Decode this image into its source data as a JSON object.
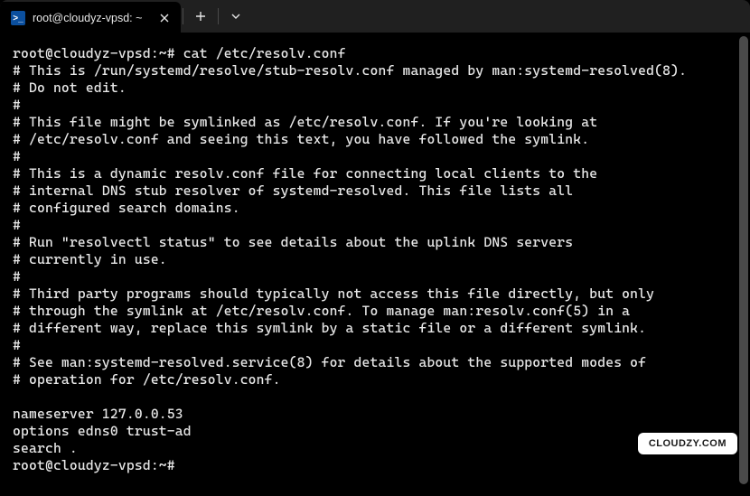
{
  "tab": {
    "title": "root@cloudyz-vpsd: ~",
    "icon_glyph": ">_"
  },
  "terminal": {
    "prompt1": "root@cloudyz-vpsd:~#",
    "command1": "cat /etc/resolv.conf",
    "lines": [
      "# This is /run/systemd/resolve/stub-resolv.conf managed by man:systemd-resolved(8).",
      "# Do not edit.",
      "#",
      "# This file might be symlinked as /etc/resolv.conf. If you're looking at",
      "# /etc/resolv.conf and seeing this text, you have followed the symlink.",
      "#",
      "# This is a dynamic resolv.conf file for connecting local clients to the",
      "# internal DNS stub resolver of systemd-resolved. This file lists all",
      "# configured search domains.",
      "#",
      "# Run \"resolvectl status\" to see details about the uplink DNS servers",
      "# currently in use.",
      "#",
      "# Third party programs should typically not access this file directly, but only",
      "# through the symlink at /etc/resolv.conf. To manage man:resolv.conf(5) in a",
      "# different way, replace this symlink by a static file or a different symlink.",
      "#",
      "# See man:systemd-resolved.service(8) for details about the supported modes of",
      "# operation for /etc/resolv.conf.",
      "",
      "nameserver 127.0.0.53",
      "options edns0 trust-ad",
      "search ."
    ],
    "prompt2": "root@cloudyz-vpsd:~#"
  },
  "watermark": "CLOUDZY.COM"
}
